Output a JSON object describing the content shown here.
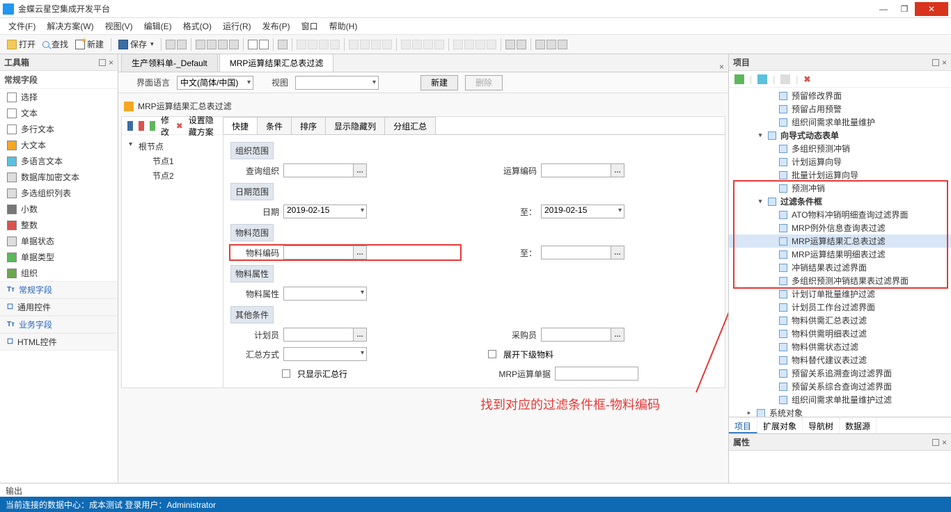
{
  "app": {
    "title": "金蝶云星空集成开发平台"
  },
  "menubar": [
    "文件(F)",
    "解决方案(W)",
    "视图(V)",
    "编辑(E)",
    "格式(O)",
    "运行(R)",
    "发布(P)",
    "窗口",
    "帮助(H)"
  ],
  "toolbar": {
    "open": "打开",
    "find": "查找",
    "new": "新建",
    "save": "保存"
  },
  "toolbox": {
    "title": "工具箱",
    "section": "常规字段",
    "items": [
      "选择",
      "文本",
      "多行文本",
      "大文本",
      "多语言文本",
      "数据库加密文本",
      "多选组织列表",
      "小数",
      "整数",
      "单据状态",
      "单据类型",
      "组织"
    ],
    "cats": [
      "常规字段",
      "通用控件",
      "业务字段",
      "HTML控件"
    ]
  },
  "tabs": {
    "tab1": "生产领料单-_Default",
    "tab2": "MRP运算结果汇总表过滤"
  },
  "subbar": {
    "langLabel": "界面语言",
    "langValue": "中文(简体/中国)",
    "viewLabel": "视图",
    "newBtn": "新建",
    "delBtn": "删除"
  },
  "formTitle": "MRP运算结果汇总表过滤",
  "leftTree": {
    "modify": "修改",
    "setScheme": "设置隐藏方案",
    "root": "根节点",
    "node1": "节点1",
    "node2": "节点2"
  },
  "innerTabs": [
    "快捷",
    "条件",
    "排序",
    "显示隐藏列",
    "分组汇总"
  ],
  "sections": {
    "org": "组织范围",
    "date": "日期范围",
    "material": "物料范围",
    "matAttr": "物料属性",
    "other": "其他条件"
  },
  "fields": {
    "queryOrg": "查询组织",
    "planCode": "运算编码",
    "dateLabel": "日期",
    "dateFrom": "2019-02-15",
    "toLabel": "至：",
    "dateTo": "2019-02-15",
    "matCode": "物料编码",
    "matAttr": "物料属性",
    "planner": "计划员",
    "buyer": "采购员",
    "summaryMode": "汇总方式",
    "expandLower": "展开下级物料",
    "onlySummary": "只显示汇总行",
    "mrpSheet": "MRP运算单据"
  },
  "annotation": "找到对应的过滤条件框-物料编码",
  "project": {
    "title": "项目",
    "items": [
      {
        "l": 3,
        "t": "预留修改界面"
      },
      {
        "l": 3,
        "t": "预留占用预警"
      },
      {
        "l": 3,
        "t": "组织间需求单批量维护"
      },
      {
        "l": 2,
        "t": "向导式动态表单",
        "caret": "▾"
      },
      {
        "l": 3,
        "t": "多组织预测冲销"
      },
      {
        "l": 3,
        "t": "计划运算向导"
      },
      {
        "l": 3,
        "t": "批量计划运算向导"
      },
      {
        "l": 3,
        "t": "预测冲销"
      },
      {
        "l": 2,
        "t": "过滤条件框",
        "caret": "▾"
      },
      {
        "l": 3,
        "t": "ATO物料冲销明细查询过滤界面"
      },
      {
        "l": 3,
        "t": "MRP例外信息查询表过滤"
      },
      {
        "l": 3,
        "t": "MRP运算结果汇总表过滤",
        "sel": true
      },
      {
        "l": 3,
        "t": "MRP运算结果明细表过滤"
      },
      {
        "l": 3,
        "t": "冲销结果表过滤界面"
      },
      {
        "l": 3,
        "t": "多组织预测冲销结果表过滤界面"
      },
      {
        "l": 3,
        "t": "计划订单批量维护过滤"
      },
      {
        "l": 3,
        "t": "计划员工作台过滤界面"
      },
      {
        "l": 3,
        "t": "物料供需汇总表过滤"
      },
      {
        "l": 3,
        "t": "物料供需明细表过滤"
      },
      {
        "l": 3,
        "t": "物料供需状态过滤"
      },
      {
        "l": 3,
        "t": "物料替代建议表过滤"
      },
      {
        "l": 3,
        "t": "预留关系追溯查询过滤界面"
      },
      {
        "l": 3,
        "t": "预留关系综合查询过滤界面"
      },
      {
        "l": 3,
        "t": "组织间需求单批量维护过滤"
      },
      {
        "l": 1,
        "t": "系统对象",
        "caret": "▸"
      }
    ],
    "bottomTabs": [
      "项目",
      "扩展对象",
      "导航树",
      "数据源"
    ]
  },
  "propTitle": "属性",
  "output": "输出",
  "status": "当前连接的数据中心：成本测试  登录用户：Administrator"
}
